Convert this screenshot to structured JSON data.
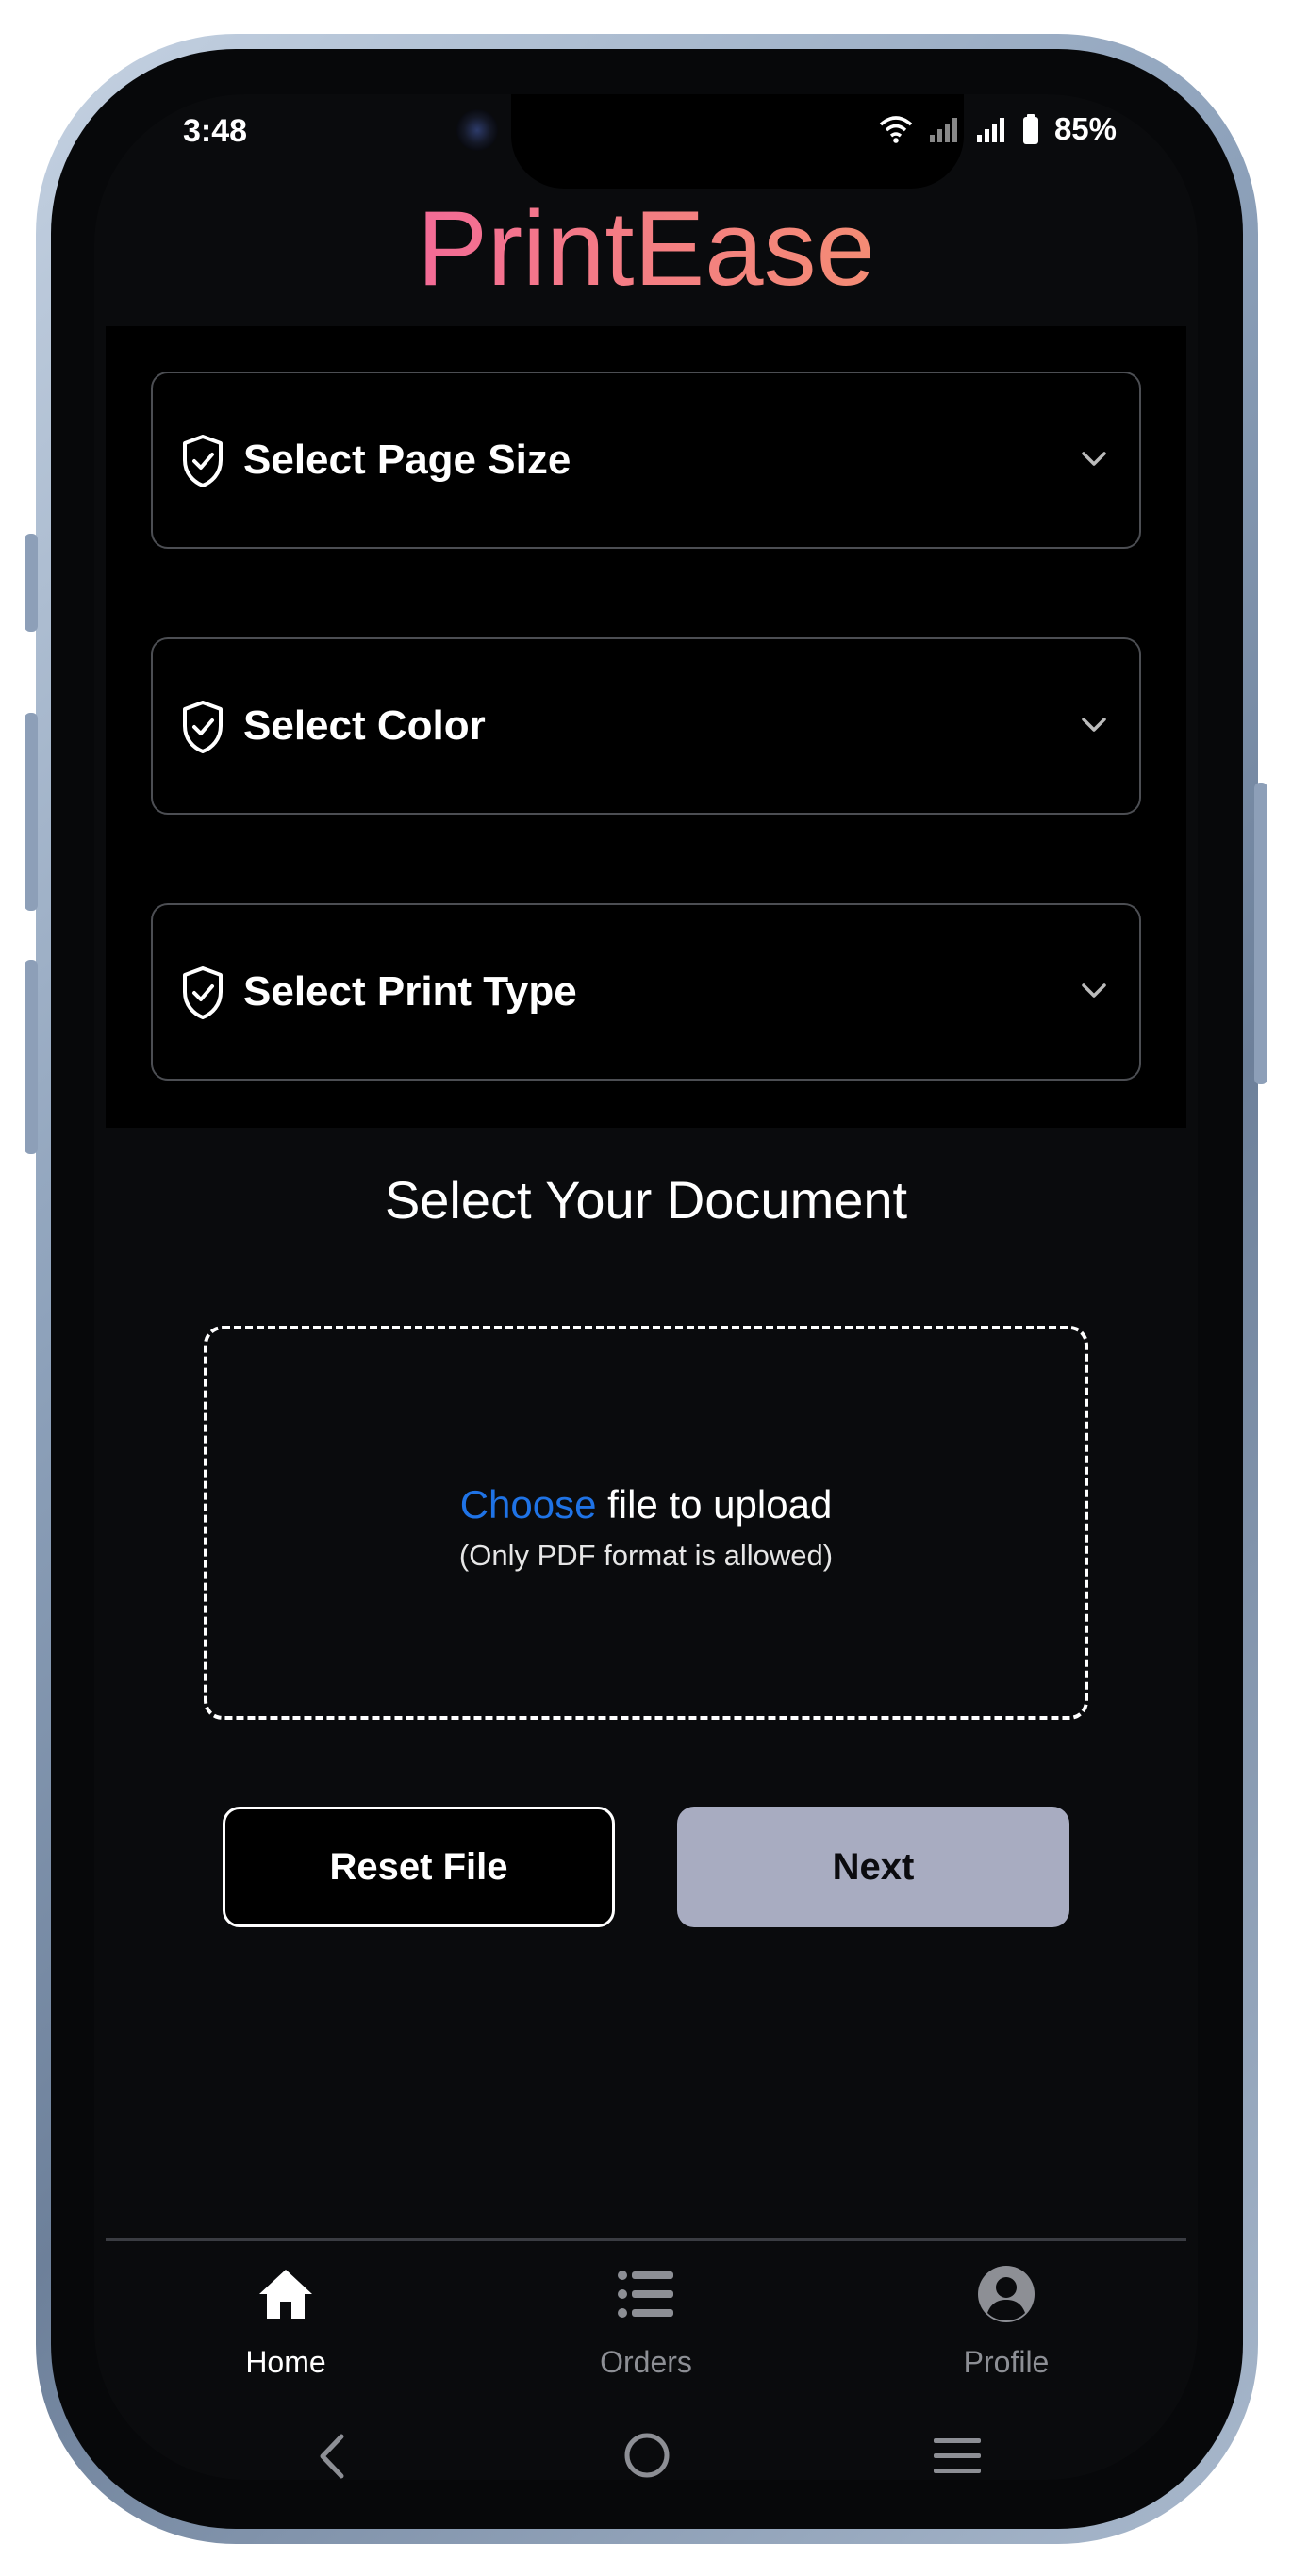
{
  "status_bar": {
    "time": "3:48",
    "battery_percent": "85%"
  },
  "app": {
    "title": "PrintEase",
    "title_gradient": [
      "#f14fb5",
      "#f4a060"
    ]
  },
  "form": {
    "dropdowns": [
      {
        "label": "Select Page Size",
        "icon": "shield-check-icon"
      },
      {
        "label": "Select Color",
        "icon": "shield-check-icon"
      },
      {
        "label": "Select Print Type",
        "icon": "shield-check-icon"
      }
    ]
  },
  "document": {
    "section_title": "Select Your Document",
    "upload_link": "Choose",
    "upload_text": " file to upload",
    "upload_hint": "(Only PDF format is allowed)"
  },
  "buttons": {
    "reset_label": "Reset File",
    "next_label": "Next"
  },
  "bottom_nav": {
    "items": [
      {
        "label": "Home",
        "icon": "home-icon",
        "active": true
      },
      {
        "label": "Orders",
        "icon": "list-icon",
        "active": false
      },
      {
        "label": "Profile",
        "icon": "profile-icon",
        "active": false
      }
    ]
  },
  "colors": {
    "accent_link": "#1f73e6",
    "next_button_bg": "#a8acc1",
    "background": "#0a0b0d"
  }
}
